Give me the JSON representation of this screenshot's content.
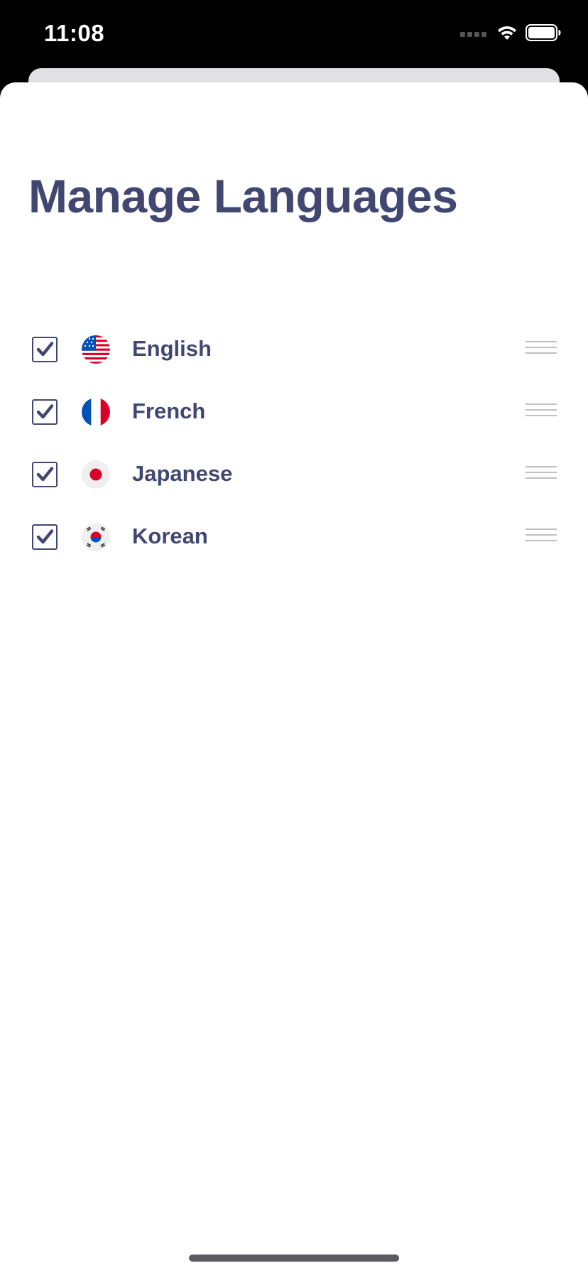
{
  "status_bar": {
    "time": "11:08",
    "icons": [
      "cellular-signal-icon",
      "wifi-icon",
      "battery-icon"
    ]
  },
  "page": {
    "title": "Manage Languages"
  },
  "languages": [
    {
      "label": "English",
      "checked": true,
      "flag": "us-flag-icon"
    },
    {
      "label": "French",
      "checked": true,
      "flag": "france-flag-icon"
    },
    {
      "label": "Japanese",
      "checked": true,
      "flag": "japan-flag-icon"
    },
    {
      "label": "Korean",
      "checked": true,
      "flag": "south-korea-flag-icon"
    }
  ],
  "colors": {
    "accent": "#414770",
    "background": "#ffffff",
    "status_bar": "#000000",
    "drag_handle": "#bfbfc4"
  }
}
